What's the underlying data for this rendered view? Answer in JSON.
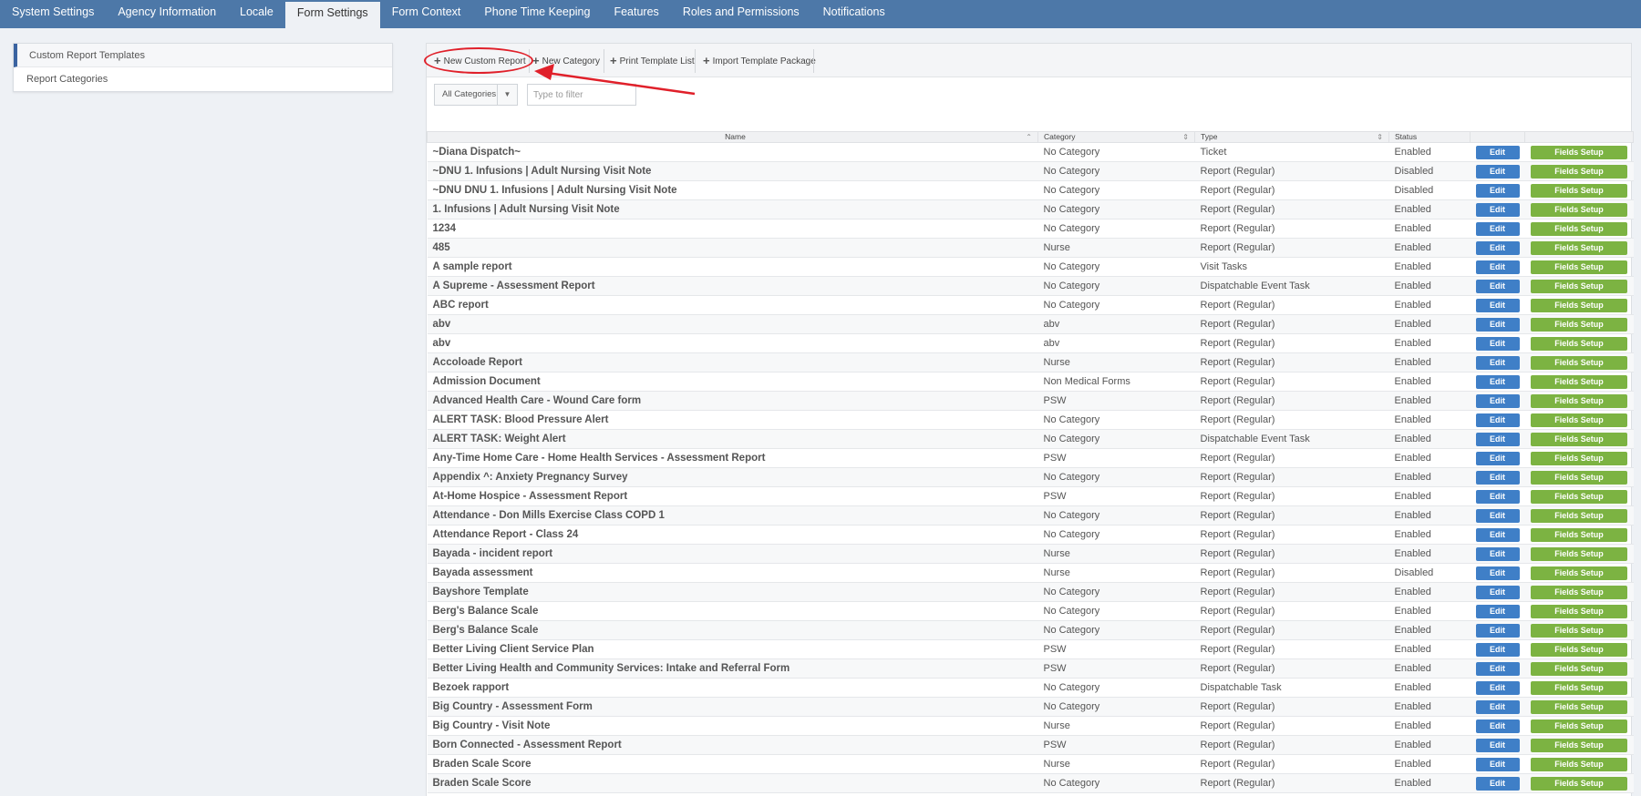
{
  "nav": {
    "tabs": [
      {
        "label": "System Settings"
      },
      {
        "label": "Agency Information"
      },
      {
        "label": "Locale"
      },
      {
        "label": "Form Settings",
        "active": true
      },
      {
        "label": "Form Context"
      },
      {
        "label": "Phone Time Keeping"
      },
      {
        "label": "Features"
      },
      {
        "label": "Roles and Permissions"
      },
      {
        "label": "Notifications"
      }
    ]
  },
  "sidebar": {
    "items": [
      {
        "label": "Custom Report Templates",
        "active": true
      },
      {
        "label": "Report Categories"
      }
    ]
  },
  "toolbar": {
    "new_custom_report": "New Custom Report",
    "new_category": "New Category",
    "print_template_list": "Print Template List",
    "import_template_package": "Import Template Package"
  },
  "filter": {
    "category_selected": "All Categories",
    "search_placeholder": "Type to filter"
  },
  "table": {
    "headers": {
      "name": "Name",
      "category": "Category",
      "type": "Type",
      "status": "Status"
    },
    "edit_label": "Edit",
    "fields_label": "Fields Setup",
    "rows": [
      [
        "~Diana Dispatch~",
        "No Category",
        "Ticket",
        "Enabled"
      ],
      [
        "~DNU 1. Infusions | Adult Nursing Visit Note",
        "No Category",
        "Report (Regular)",
        "Disabled"
      ],
      [
        "~DNU DNU 1. Infusions | Adult Nursing Visit Note",
        "No Category",
        "Report (Regular)",
        "Disabled"
      ],
      [
        "1. Infusions | Adult Nursing Visit Note",
        "No Category",
        "Report (Regular)",
        "Enabled"
      ],
      [
        "1234",
        "No Category",
        "Report (Regular)",
        "Enabled"
      ],
      [
        "485",
        "Nurse",
        "Report (Regular)",
        "Enabled"
      ],
      [
        "A sample report",
        "No Category",
        "Visit Tasks",
        "Enabled"
      ],
      [
        "A Supreme - Assessment Report",
        "No Category",
        "Dispatchable Event Task",
        "Enabled"
      ],
      [
        "ABC report",
        "No Category",
        "Report (Regular)",
        "Enabled"
      ],
      [
        "abv",
        "abv",
        "Report (Regular)",
        "Enabled"
      ],
      [
        "abv",
        "abv",
        "Report (Regular)",
        "Enabled"
      ],
      [
        "Accoloade Report",
        "Nurse",
        "Report (Regular)",
        "Enabled"
      ],
      [
        "Admission Document",
        "Non Medical Forms",
        "Report (Regular)",
        "Enabled"
      ],
      [
        "Advanced Health Care - Wound Care form",
        "PSW",
        "Report (Regular)",
        "Enabled"
      ],
      [
        "ALERT TASK: Blood Pressure Alert",
        "No Category",
        "Report (Regular)",
        "Enabled"
      ],
      [
        "ALERT TASK: Weight Alert",
        "No Category",
        "Dispatchable Event Task",
        "Enabled"
      ],
      [
        "Any-Time Home Care - Home Health Services - Assessment Report",
        "PSW",
        "Report (Regular)",
        "Enabled"
      ],
      [
        "Appendix ^: Anxiety Pregnancy Survey",
        "No Category",
        "Report (Regular)",
        "Enabled"
      ],
      [
        "At-Home Hospice - Assessment Report",
        "PSW",
        "Report (Regular)",
        "Enabled"
      ],
      [
        "Attendance - Don Mills Exercise Class COPD 1",
        "No Category",
        "Report (Regular)",
        "Enabled"
      ],
      [
        "Attendance Report - Class 24",
        "No Category",
        "Report (Regular)",
        "Enabled"
      ],
      [
        "Bayada - incident report",
        "Nurse",
        "Report (Regular)",
        "Enabled"
      ],
      [
        "Bayada assessment",
        "Nurse",
        "Report (Regular)",
        "Disabled"
      ],
      [
        "Bayshore Template",
        "No Category",
        "Report (Regular)",
        "Enabled"
      ],
      [
        "Berg's Balance Scale",
        "No Category",
        "Report (Regular)",
        "Enabled"
      ],
      [
        "Berg's Balance Scale",
        "No Category",
        "Report (Regular)",
        "Enabled"
      ],
      [
        "Better Living Client Service Plan",
        "PSW",
        "Report (Regular)",
        "Enabled"
      ],
      [
        "Better Living Health and Community Services: Intake and Referral Form",
        "PSW",
        "Report (Regular)",
        "Enabled"
      ],
      [
        "Bezoek rapport",
        "No Category",
        "Dispatchable Task",
        "Enabled"
      ],
      [
        "Big Country - Assessment Form",
        "No Category",
        "Report (Regular)",
        "Enabled"
      ],
      [
        "Big Country - Visit Note",
        "Nurse",
        "Report (Regular)",
        "Enabled"
      ],
      [
        "Born Connected - Assessment Report",
        "PSW",
        "Report (Regular)",
        "Enabled"
      ],
      [
        "Braden Scale Score",
        "Nurse",
        "Report (Regular)",
        "Enabled"
      ],
      [
        "Braden Scale Score",
        "No Category",
        "Report (Regular)",
        "Enabled"
      ]
    ]
  }
}
